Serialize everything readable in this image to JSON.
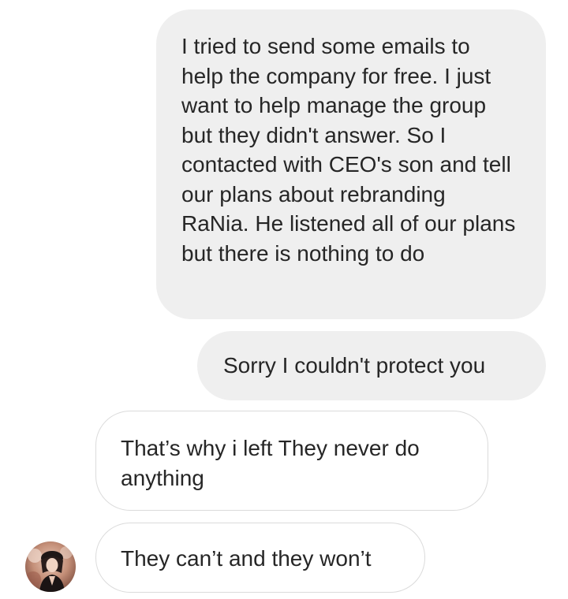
{
  "conversation": {
    "messages": [
      {
        "direction": "sent",
        "text": "I tried to send some emails to help the company for free. I just want to help manage the group but they didn't answer. So I contacted with CEO's son and tell our plans about rebranding RaNia. He listened all of our plans but there is nothing to do"
      },
      {
        "direction": "sent",
        "text": "Sorry I couldn't protect you"
      },
      {
        "direction": "received",
        "text": "That’s why i left They never do anything"
      },
      {
        "direction": "received",
        "text": "They can’t and they won’t"
      }
    ]
  },
  "colors": {
    "sent_bubble": "#efefef",
    "received_border": "#dbdbdb",
    "text": "#262626",
    "background": "#ffffff"
  },
  "icons": {
    "avatar": "contact-avatar-photo"
  }
}
